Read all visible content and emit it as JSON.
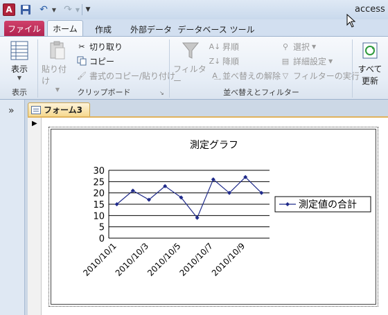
{
  "titlebar": {
    "app_icon_label": "A",
    "window_title": "access Ⅰ"
  },
  "tabs": {
    "file": "ファイル",
    "home": "ホーム",
    "create": "作成",
    "external": "外部データ",
    "dbtools": "データベース ツール"
  },
  "ribbon": {
    "view_group": {
      "view_button": "表示",
      "label": "表示"
    },
    "clipboard_group": {
      "paste": "貼り付け",
      "cut": "切り取り",
      "copy": "コピー",
      "format_painter": "書式のコピー/貼り付け",
      "label": "クリップボード"
    },
    "sort_group": {
      "filter": "フィルター",
      "ascending": "昇順",
      "descending": "降順",
      "remove_sort": "並べ替えの解除",
      "selection": "選択",
      "advanced": "詳細設定",
      "toggle_filter": "フィルターの実行",
      "label": "並べ替えとフィルター"
    },
    "records_group": {
      "refresh_all_line1": "すべて",
      "refresh_all_line2": "更新"
    }
  },
  "nav": {
    "toggle": "»"
  },
  "document": {
    "tab_label": "フォーム3"
  },
  "colors": {
    "series": "#1f2a8a",
    "file_tab": "#b12451",
    "form_tab": "#f6d98f"
  },
  "chart_data": {
    "type": "line",
    "title": "測定グラフ",
    "x": [
      "2010/10/1",
      "2010/10/2",
      "2010/10/3",
      "2010/10/4",
      "2010/10/5",
      "2010/10/6",
      "2010/10/7",
      "2010/10/8",
      "2010/10/9",
      "2010/10/10"
    ],
    "x_tick_labels": [
      "2010/10/1",
      "2010/10/3",
      "2010/10/5",
      "2010/10/7",
      "2010/10/9"
    ],
    "series": [
      {
        "name": "測定値の合計",
        "values": [
          15,
          21,
          17,
          23,
          18,
          9,
          26,
          20,
          27,
          20
        ]
      }
    ],
    "y_ticks": [
      0,
      5,
      10,
      15,
      20,
      25,
      30
    ],
    "ylim": [
      0,
      30
    ],
    "grid": "horizontal",
    "legend": "right"
  }
}
